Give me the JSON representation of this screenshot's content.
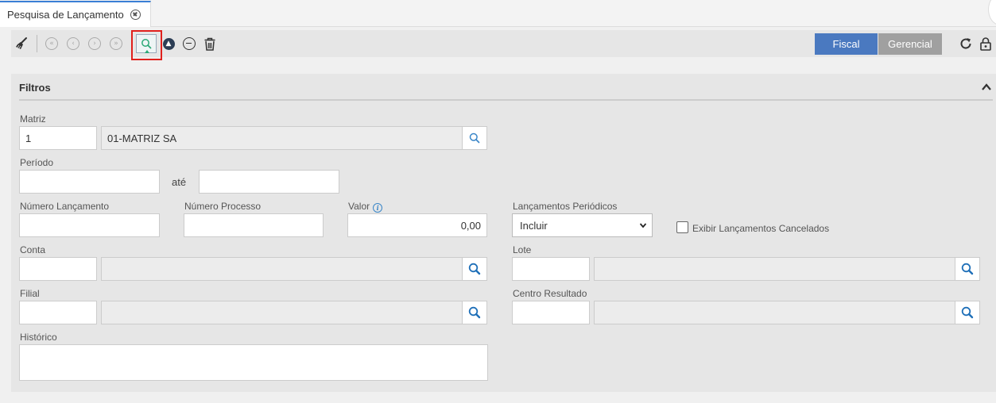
{
  "tab": {
    "title": "Pesquisa de Lançamento",
    "close_icon": "close-circle-icon"
  },
  "toolbar": {
    "icons": [
      "broom-icon",
      "first-icon",
      "previous-icon",
      "next-icon",
      "last-icon",
      "search-icon",
      "upload-icon",
      "remove-icon",
      "trash-icon",
      "refresh-icon",
      "lock-icon"
    ],
    "fiscal_label": "Fiscal",
    "gerencial_label": "Gerencial"
  },
  "filters": {
    "title": "Filtros",
    "matriz": {
      "label": "Matriz",
      "code": "1",
      "name": "01-MATRIZ SA"
    },
    "periodo": {
      "label": "Período",
      "separator": "até",
      "start": "",
      "end": ""
    },
    "numero_lancamento": {
      "label": "Número Lançamento",
      "value": ""
    },
    "numero_processo": {
      "label": "Número Processo",
      "value": ""
    },
    "valor": {
      "label": "Valor",
      "value": "0,00"
    },
    "lancamentos_periodicos": {
      "label": "Lançamentos Periódicos",
      "selected": "Incluir"
    },
    "exibir_cancelados": {
      "label": "Exibir Lançamentos Cancelados",
      "checked": false
    },
    "conta": {
      "label": "Conta",
      "code": "",
      "name": ""
    },
    "lote": {
      "label": "Lote",
      "code": "",
      "name": ""
    },
    "filial": {
      "label": "Filial",
      "code": "",
      "name": ""
    },
    "centro_resultado": {
      "label": "Centro Resultado",
      "code": "",
      "name": ""
    },
    "historico": {
      "label": "Histórico",
      "value": ""
    }
  },
  "colors": {
    "accent": "#4a79c0",
    "secondary": "#a0a0a0",
    "highlight": "#e0201c",
    "tab_border": "#3a7fd5",
    "lookup_icon": "#3a86c8"
  }
}
